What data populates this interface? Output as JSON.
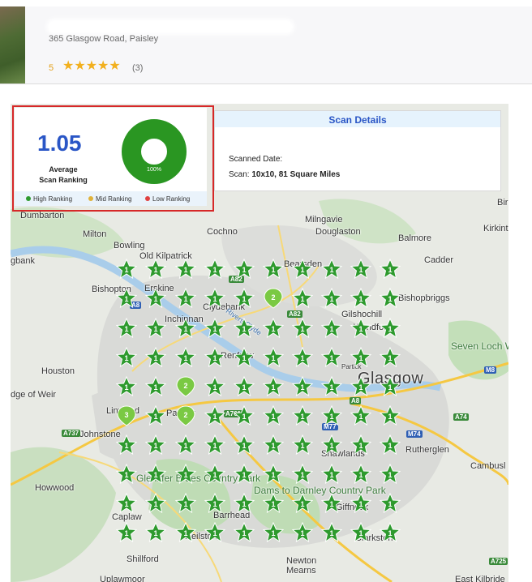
{
  "business": {
    "address": "365 Glasgow Road, Paisley",
    "rating": "5",
    "stars": "★★★★★",
    "review_count": "(3)"
  },
  "summary": {
    "average_value": "1.05",
    "average_label_line1": "Average",
    "average_label_line2": "Scan Ranking",
    "donut_percent": "100%",
    "donut_fill_fraction": 1.0,
    "legend": [
      {
        "label": "High Ranking",
        "color": "#2e9a2e"
      },
      {
        "label": "Mid Ranking",
        "color": "#e0b23a"
      },
      {
        "label": "Low Ranking",
        "color": "#e04040"
      }
    ]
  },
  "scan_details": {
    "title": "Scan Details",
    "date_label": "Scanned Date:",
    "scan_label": "Scan:",
    "scan_value": "10x10, 81 Square Miles"
  },
  "map": {
    "places": [
      "Dumbarton",
      "Milton",
      "Cochno",
      "Milngavie",
      "Douglaston",
      "Balmore",
      "Kirkint",
      "Bowling",
      "Old Kilpatrick",
      "Bearsden",
      "Cadder",
      "gbank",
      "Bishopton",
      "Erskine",
      "Clydebank",
      "Bishopbriggs",
      "Gilshochill",
      "Inchinnan",
      "Wyndford",
      "Renfrew",
      "Seven Loch Wetland Park",
      "Houston",
      "Glasgow",
      "dge of Weir",
      "Linwood",
      "Paisley",
      "Rutherglen",
      "Johnstone",
      "Shawlands",
      "Cambusl",
      "Howwood",
      "Gleniffer Braes Country Park",
      "Dams to Darnley Country Park",
      "Caplaw",
      "Barrhead",
      "Giffnock",
      "Neilston",
      "Clarkston",
      "Shillford",
      "Newton Mearns",
      "Uplawmoor",
      "East Kilbride",
      "Birdst",
      "Rivers Clyde",
      "Partick"
    ],
    "roads": [
      "A82",
      "A82",
      "A8",
      "M8",
      "A737",
      "A761",
      "M77",
      "M74",
      "A74",
      "A725",
      "A8"
    ],
    "pin_colors": {
      "high": "#2e9a2e",
      "high_light": "#7ac943"
    },
    "star_pins": [
      {
        "rank": "1",
        "color": "#2e9a2e"
      }
    ],
    "drop_pins": [
      {
        "rank": "2",
        "color": "#7ac943"
      },
      {
        "rank": "2",
        "color": "#7ac943"
      },
      {
        "rank": "3",
        "color": "#7ac943"
      },
      {
        "rank": "2",
        "color": "#7ac943"
      }
    ]
  }
}
